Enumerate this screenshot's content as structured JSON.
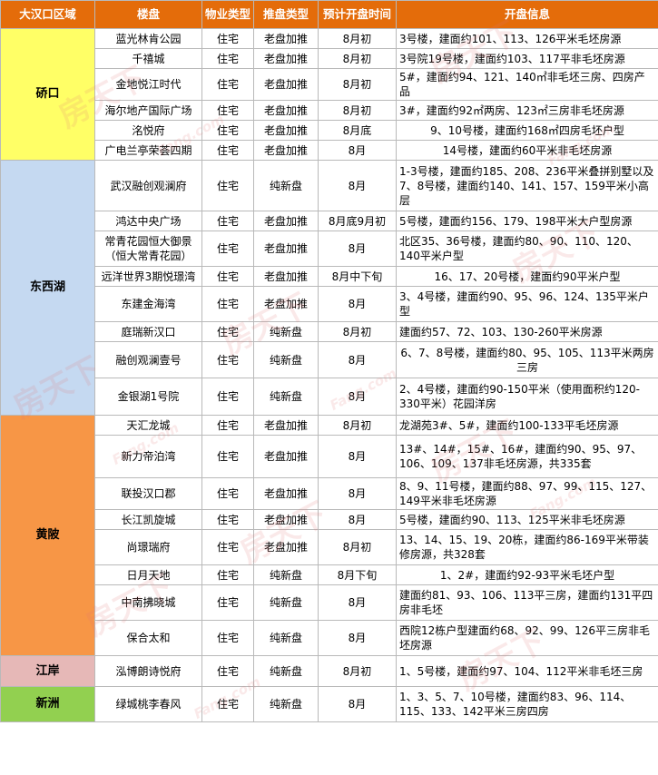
{
  "header": {
    "region": "大汉口区域",
    "project": "楼盘",
    "property_type": "物业类型",
    "push_type": "推盘类型",
    "open_time": "预计开盘时间",
    "open_info": "开盘信息"
  },
  "colors": {
    "header_bg": "#e46c0a",
    "qiaokou": "#ffff66",
    "dongxihu": "#c5d9f1",
    "huangpi": "#f79646",
    "jiangan": "#e6b8b7",
    "xinzhou": "#92d050"
  },
  "watermark": {
    "brand": "房天下",
    "domain": "Fang.com"
  },
  "regions": [
    {
      "name": "硚口",
      "color_key": "qiaokou",
      "rows": [
        {
          "project": "蓝光林肯公园",
          "property": "住宅",
          "push": "老盘加推",
          "time": "8月初",
          "info": "3号楼，建面约101、113、126平米毛坯房源"
        },
        {
          "project": "千禧城",
          "property": "住宅",
          "push": "老盘加推",
          "time": "8月初",
          "info": "3号院19号楼，建面约103、117平非毛坯房源"
        },
        {
          "project": "金地悦江时代",
          "property": "住宅",
          "push": "老盘加推",
          "time": "8月初",
          "info": "5#，建面约94、121、140㎡非毛坯三房、四房产品"
        },
        {
          "project": "海尔地产国际广场",
          "property": "住宅",
          "push": "老盘加推",
          "time": "8月初",
          "info": "3#，建面约92㎡两房、123㎡三房非毛坯房源"
        },
        {
          "project": "洺悦府",
          "property": "住宅",
          "push": "老盘加推",
          "time": "8月底",
          "info": "9、10号楼，建面约168㎡四房毛坯户型"
        },
        {
          "project": "广电兰亭荣荟四期",
          "property": "住宅",
          "push": "老盘加推",
          "time": "8月",
          "info": "14号楼，建面约60平米非毛坯房源"
        }
      ]
    },
    {
      "name": "东西湖",
      "color_key": "dongxihu",
      "rows": [
        {
          "project": "武汉融创观澜府",
          "property": "住宅",
          "push": "纯新盘",
          "time": "8月",
          "info": "1-3号楼，建面约185、208、236平米叠拼别墅以及7、8号楼，建面约140、141、157、159平米小高层"
        },
        {
          "project": "鸿达中央广场",
          "property": "住宅",
          "push": "老盘加推",
          "time": "8月底9月初",
          "info": "5号楼，建面约156、179、198平米大户型房源"
        },
        {
          "project": "常青花园恒大御景（恒大常青花园）",
          "property": "住宅",
          "push": "老盘加推",
          "time": "8月",
          "info": "北区35、36号楼，建面约80、90、110、120、140平米户型"
        },
        {
          "project": "远洋世界3期悦璟湾",
          "property": "住宅",
          "push": "老盘加推",
          "time": "8月中下旬",
          "info": "16、17、20号楼，建面约90平米户型"
        },
        {
          "project": "东建金海湾",
          "property": "住宅",
          "push": "老盘加推",
          "time": "8月",
          "info": "3、4号楼，建面约90、95、96、124、135平米户型"
        },
        {
          "project": "庭瑞新汉口",
          "property": "住宅",
          "push": "纯新盘",
          "time": "8月初",
          "info": "建面约57、72、103、130-260平米房源"
        },
        {
          "project": "融创观澜壹号",
          "property": "住宅",
          "push": "纯新盘",
          "time": "8月",
          "info": "6、7、8号楼，建面约80、95、105、113平米两房三房"
        },
        {
          "project": "金银湖1号院",
          "property": "住宅",
          "push": "纯新盘",
          "time": "8月",
          "info": "2、4号楼，建面约90-150平米（使用面积约120-330平米）花园洋房"
        }
      ]
    },
    {
      "name": "黄陂",
      "color_key": "huangpi",
      "rows": [
        {
          "project": "天汇龙城",
          "property": "住宅",
          "push": "老盘加推",
          "time": "8月初",
          "info": "龙湖苑3#、5#，建面约100-133平毛坯房源"
        },
        {
          "project": "新力帝泊湾",
          "property": "住宅",
          "push": "老盘加推",
          "time": "8月",
          "info": "13#、14#，15#、16#，建面约90、95、97、106、109、137非毛坯房源，共335套"
        },
        {
          "project": "联投汉口郡",
          "property": "住宅",
          "push": "老盘加推",
          "time": "8月",
          "info": "8、9、11号楼，建面约88、97、99、115、127、149平米非毛坯房源"
        },
        {
          "project": "长江凯旋城",
          "property": "住宅",
          "push": "老盘加推",
          "time": "8月",
          "info": "5号楼，建面约90、113、125平米非毛坯房源"
        },
        {
          "project": "尚璟瑞府",
          "property": "住宅",
          "push": "老盘加推",
          "time": "8月初",
          "info": "13、14、15、19、20栋，建面约86-169平米带装修房源，共328套"
        },
        {
          "project": "日月天地",
          "property": "住宅",
          "push": "纯新盘",
          "time": "8月下旬",
          "info": "1、2#，建面约92-93平米毛坯户型"
        },
        {
          "project": "中南拂晓城",
          "property": "住宅",
          "push": "纯新盘",
          "time": "8月",
          "info": "建面约81、93、106、113平三房，建面约131平四房非毛坯"
        },
        {
          "project": "保合太和",
          "property": "住宅",
          "push": "纯新盘",
          "time": "8月",
          "info": "西院12栋户型建面约68、92、99、126平三房非毛坯房源"
        }
      ]
    },
    {
      "name": "江岸",
      "color_key": "jiangan",
      "rows": [
        {
          "project": "泓博朗诗悦府",
          "property": "住宅",
          "push": "纯新盘",
          "time": "8月初",
          "info": "1、5号楼，建面约97、104、112平米非毛坯三房"
        }
      ]
    },
    {
      "name": "新洲",
      "color_key": "xinzhou",
      "rows": [
        {
          "project": "绿城桃李春风",
          "property": "住宅",
          "push": "纯新盘",
          "time": "8月",
          "info": "1、3、5、7、10号楼，建面约83、96、114、115、133、142平米三房四房"
        }
      ]
    }
  ]
}
